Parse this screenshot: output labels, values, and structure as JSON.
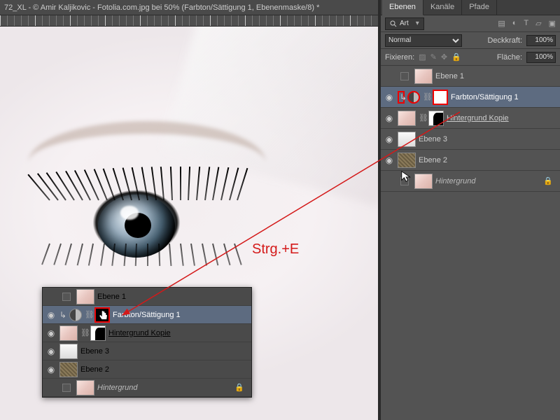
{
  "window": {
    "title": "72_XL - © Amir Kaljikovic - Fotolia.com.jpg bei 50% (Farbton/Sättigung 1, Ebenenmaske/8) *",
    "close": "×"
  },
  "panel": {
    "tabs": {
      "layers": "Ebenen",
      "channels": "Kanäle",
      "paths": "Pfade"
    },
    "filter_label": "Art",
    "blend_mode": "Normal",
    "opacity_label": "Deckkraft:",
    "opacity_value": "100%",
    "lock_label": "Fixieren:",
    "fill_label": "Fläche:",
    "fill_value": "100%"
  },
  "layers": [
    {
      "name": "Ebene 1",
      "eye": "",
      "type": "normal",
      "thumb": "face"
    },
    {
      "name": "Farbton/Sättigung 1",
      "eye": "◉",
      "type": "adj",
      "selected": true
    },
    {
      "name": "Hintergrund Kopie",
      "eye": "◉",
      "type": "masked",
      "underline": true
    },
    {
      "name": "Ebene 3",
      "eye": "◉",
      "type": "normal",
      "thumb": "grey"
    },
    {
      "name": "Ebene 2",
      "eye": "◉",
      "type": "normal",
      "thumb": "tex"
    },
    {
      "name": "Hintergrund",
      "eye": "",
      "type": "bg",
      "thumb": "face",
      "locked": true,
      "italic": true
    }
  ],
  "annotation": {
    "shortcut": "Strg.+E"
  }
}
